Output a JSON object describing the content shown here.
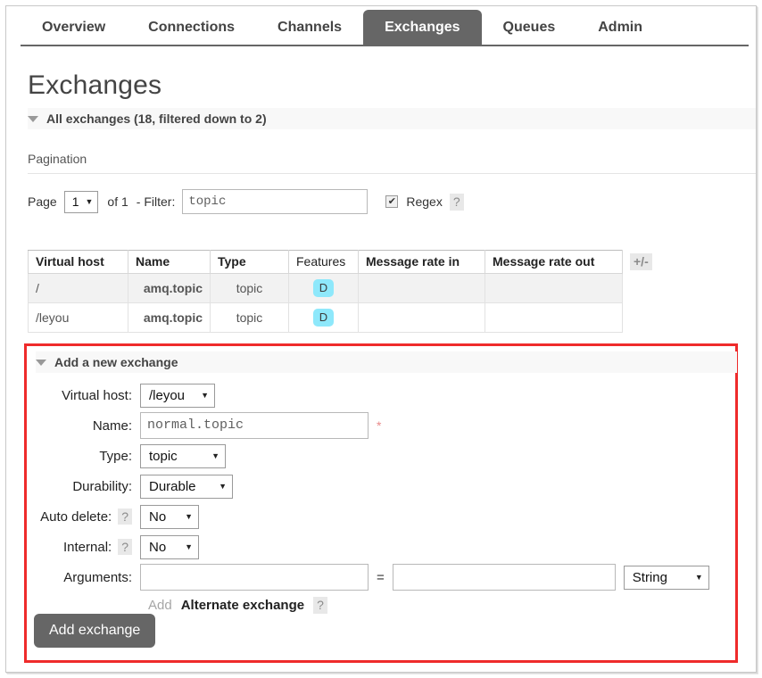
{
  "tabs": [
    {
      "label": "Overview",
      "active": false
    },
    {
      "label": "Connections",
      "active": false
    },
    {
      "label": "Channels",
      "active": false
    },
    {
      "label": "Exchanges",
      "active": true
    },
    {
      "label": "Queues",
      "active": false
    },
    {
      "label": "Admin",
      "active": false
    }
  ],
  "page": {
    "title": "Exchanges"
  },
  "all_exchanges": {
    "header": "All exchanges (18, filtered down to 2)"
  },
  "pagination": {
    "label": "Pagination",
    "page_label": "Page",
    "page_value": "1",
    "of_label": "of 1",
    "filter_label": "- Filter:",
    "filter_value": "topic",
    "filter_placeholder": "",
    "regex_label": "Regex",
    "regex_checked": true,
    "regex_check_glyph": "✔",
    "help_glyph": "?"
  },
  "table": {
    "columns": [
      "Virtual host",
      "Name",
      "Type",
      "Features",
      "Message rate in",
      "Message rate out"
    ],
    "plus_minus": "+/-",
    "rows": [
      {
        "vhost": "/",
        "name": "amq.topic",
        "type": "topic",
        "features": "D",
        "rate_in": "",
        "rate_out": ""
      },
      {
        "vhost": "/leyou",
        "name": "amq.topic",
        "type": "topic",
        "features": "D",
        "rate_in": "",
        "rate_out": ""
      }
    ]
  },
  "add_exchange": {
    "header": "Add a new exchange",
    "fields": {
      "vhost_label": "Virtual host:",
      "vhost_value": "/leyou",
      "name_label": "Name:",
      "name_value": "normal.topic",
      "name_required_mark": "*",
      "type_label": "Type:",
      "type_value": "topic",
      "durability_label": "Durability:",
      "durability_value": "Durable",
      "autodelete_label": "Auto delete:",
      "autodelete_value": "No",
      "internal_label": "Internal:",
      "internal_value": "No",
      "arguments_label": "Arguments:",
      "argument_key_value": "",
      "argument_equals": "=",
      "argument_val_value": "",
      "argument_type_value": "String",
      "add_link": "Add",
      "alternate_exchange": "Alternate exchange",
      "help_glyph": "?"
    },
    "submit_label": "Add exchange"
  },
  "colors": {
    "accent_tab": "#666666",
    "highlight_box": "#ef2b2b",
    "feature_badge": "#8ee8fb"
  },
  "icons": {
    "caret_down": "▼",
    "select_arrow": "▼"
  }
}
